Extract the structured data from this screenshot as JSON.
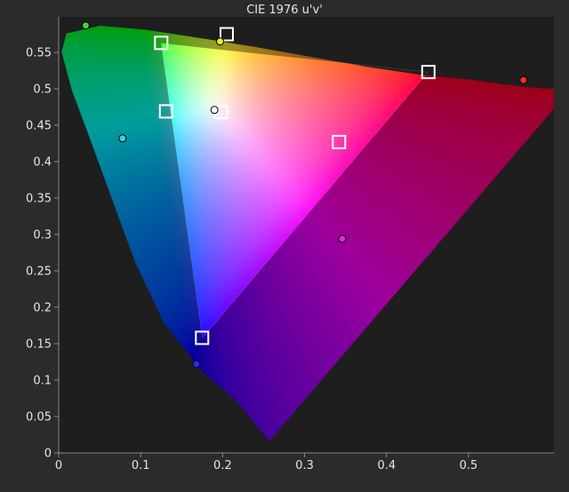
{
  "chart_data": {
    "type": "scatter",
    "title": "CIE 1976 u'v'",
    "xlabel": "",
    "ylabel": "",
    "xlim": [
      0,
      0.6
    ],
    "ylim": [
      0,
      0.6
    ],
    "x_ticks": [
      0,
      0.1,
      0.2,
      0.3,
      0.4,
      0.5
    ],
    "x_tick_labels": [
      "0",
      "0.1",
      "0.2",
      "0.3",
      "0.4",
      "0.5"
    ],
    "y_ticks": [
      0,
      0.05,
      0.1,
      0.15,
      0.2,
      0.25,
      0.3,
      0.35,
      0.4,
      0.45,
      0.5,
      0.55
    ],
    "y_tick_labels": [
      "0",
      "0.05",
      "0.1",
      "0.15",
      "0.2",
      "0.25",
      "0.3",
      "0.35",
      "0.4",
      "0.45",
      "0.5",
      "0.55"
    ],
    "grid": false,
    "background": "#1e1e1e",
    "series": [
      {
        "marker": "square",
        "color": "#ffffff",
        "points": [
          {
            "u": 0.451,
            "v": 0.523
          },
          {
            "u": 0.125,
            "v": 0.563
          },
          {
            "u": 0.175,
            "v": 0.158
          },
          {
            "u": 0.205,
            "v": 0.575
          },
          {
            "u": 0.131,
            "v": 0.469
          },
          {
            "u": 0.342,
            "v": 0.427
          },
          {
            "u": 0.198,
            "v": 0.468
          }
        ]
      },
      {
        "marker": "circle",
        "points": [
          {
            "u": 0.567,
            "v": 0.512,
            "color": "#ff2a2a"
          },
          {
            "u": 0.033,
            "v": 0.587,
            "color": "#3fd43f"
          },
          {
            "u": 0.168,
            "v": 0.122,
            "color": "#2a2aff"
          },
          {
            "u": 0.197,
            "v": 0.565,
            "color": "#f2ea20"
          },
          {
            "u": 0.078,
            "v": 0.432,
            "color": "#35d7d7"
          },
          {
            "u": 0.346,
            "v": 0.294,
            "color": "#d035d0"
          },
          {
            "u": 0.19,
            "v": 0.471,
            "color": "#ffffff"
          }
        ]
      }
    ],
    "spectral_locus": [
      [
        0.2568,
        0.0165
      ],
      [
        0.2174,
        0.0708
      ],
      [
        0.1766,
        0.1103
      ],
      [
        0.1286,
        0.1787
      ],
      [
        0.0937,
        0.2608
      ],
      [
        0.0707,
        0.3313
      ],
      [
        0.0437,
        0.4147
      ],
      [
        0.0161,
        0.4985
      ],
      [
        0.0036,
        0.5507
      ],
      [
        0.0096,
        0.576
      ],
      [
        0.0501,
        0.5866
      ],
      [
        0.1066,
        0.581
      ],
      [
        0.1676,
        0.5705
      ],
      [
        0.2361,
        0.5581
      ],
      [
        0.3064,
        0.544
      ],
      [
        0.3759,
        0.5302
      ],
      [
        0.4414,
        0.5193
      ],
      [
        0.5025,
        0.5124
      ],
      [
        0.5471,
        0.5054
      ],
      [
        0.5796,
        0.5014
      ],
      [
        0.602,
        0.5
      ],
      [
        0.6174,
        0.499
      ],
      [
        0.6234,
        0.498
      ]
    ],
    "gamut_triangle": [
      [
        0.4507,
        0.5229
      ],
      [
        0.125,
        0.5625
      ],
      [
        0.1754,
        0.1579
      ]
    ]
  }
}
